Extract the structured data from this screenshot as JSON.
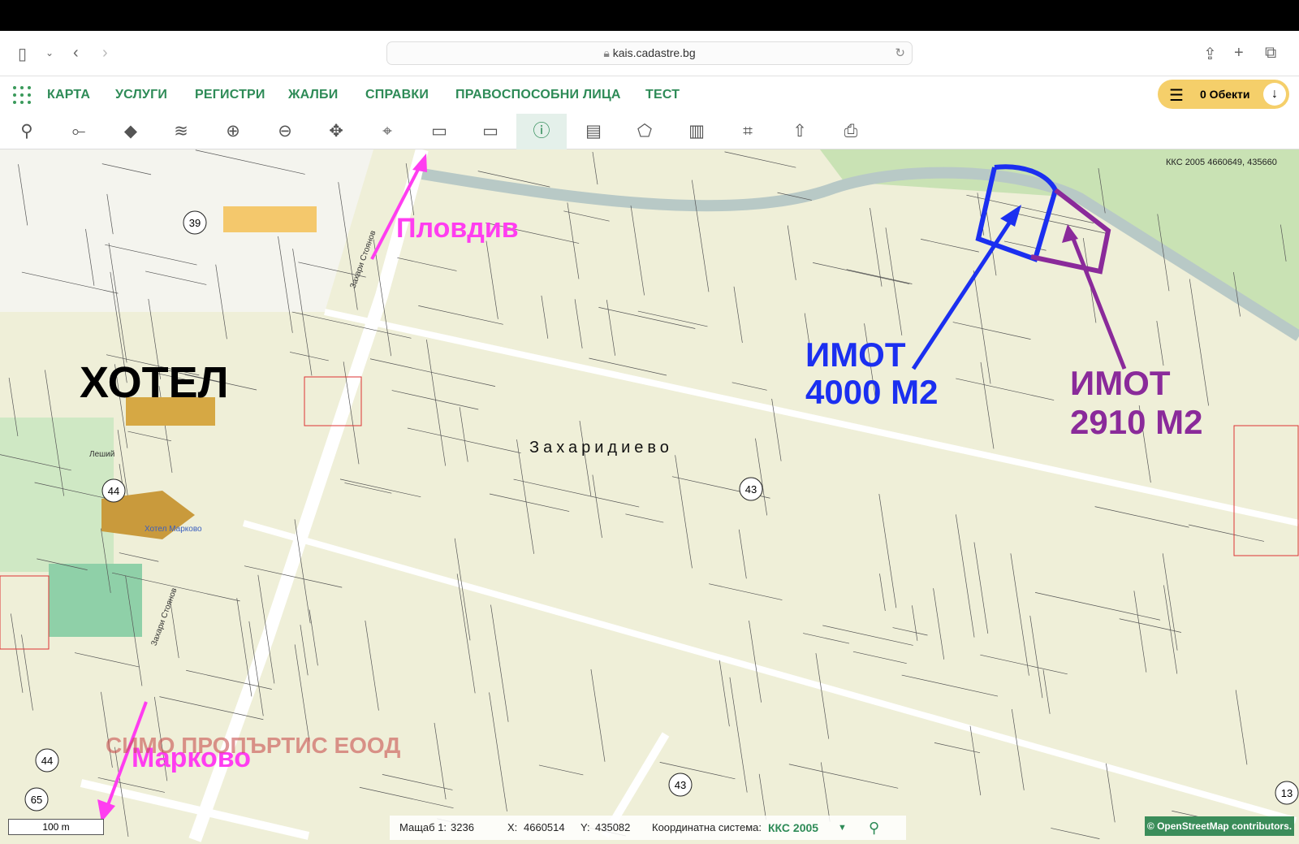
{
  "browser": {
    "url": "kais.cadastre.bg"
  },
  "nav": {
    "items": [
      "КАРТА",
      "УСЛУГИ",
      "РЕГИСТРИ",
      "ЖАЛБИ",
      "СПРАВКИ",
      "ПРАВОСПОСОБНИ ЛИЦА",
      "ТЕСТ"
    ],
    "objects_label": "0 Обекти"
  },
  "toolbar": {
    "tools": [
      "search-icon",
      "route-icon",
      "layer-icon",
      "layers-icon",
      "zoom-in-icon",
      "zoom-out-icon",
      "pan-icon",
      "pin-icon",
      "select-rect-icon",
      "deselect-rect-icon",
      "info-icon",
      "measure-icon",
      "polygon-icon",
      "map-icon",
      "crosshair-icon",
      "export-icon",
      "print-icon"
    ],
    "active": "info-icon",
    "accent": "#2e8b57"
  },
  "map": {
    "coords_readout": "ККС 2005 4660649, 435660",
    "labels": {
      "hotel": "ХОТЕЛ",
      "plovdiv": "Пловдив",
      "markovo": "Марково",
      "village": "Захаридиево",
      "company": "СИМО ПРОПЪРТИС ЕООД",
      "street": "Захари Стоянов",
      "street2": "Захари Стоянов",
      "hotel_small": "Хотел Марково",
      "lesh": "Леший"
    },
    "property1": {
      "line1": "ИМОТ",
      "line2": "4000 М2",
      "color": "#1b2ff0"
    },
    "property2": {
      "line1": "ИМОТ",
      "line2": "2910 М2",
      "color": "#8a2a9a"
    },
    "arrow_color": "#ff3df0",
    "shields": [
      "39",
      "44",
      "44",
      "43",
      "43",
      "13",
      "65"
    ]
  },
  "status": {
    "scale_label": "Мащаб 1:",
    "scale_value": "3236",
    "x_label": "X:",
    "x_value": "4660514",
    "y_label": "Y:",
    "y_value": "435082",
    "crs_label": "Координатна система:",
    "crs_value": "ККС 2005"
  },
  "scalebar": "100 m",
  "attribution": "© OpenStreetMap contributors."
}
